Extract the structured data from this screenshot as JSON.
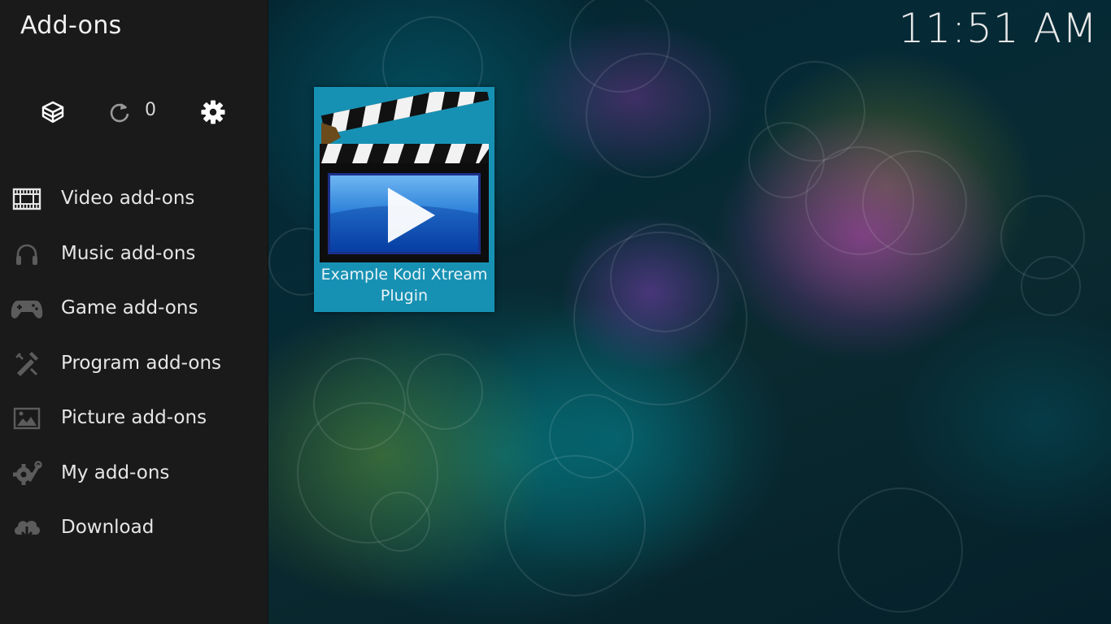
{
  "window": {
    "title": "Add-ons",
    "clock": "11:51 AM"
  },
  "toolbar": {
    "install_icon": "box-install-icon",
    "update_icon": "refresh-icon",
    "update_count": "0",
    "settings_icon": "gear-icon"
  },
  "sidebar": {
    "items": [
      {
        "label": "Video add-ons",
        "icon": "film-icon"
      },
      {
        "label": "Music add-ons",
        "icon": "headphones-icon"
      },
      {
        "label": "Game add-ons",
        "icon": "gamepad-icon"
      },
      {
        "label": "Program add-ons",
        "icon": "tools-icon"
      },
      {
        "label": "Picture add-ons",
        "icon": "picture-icon"
      },
      {
        "label": "My add-ons",
        "icon": "wrench-gear-icon"
      },
      {
        "label": "Download",
        "icon": "cloud-download-icon"
      }
    ]
  },
  "addons": [
    {
      "label": "Example Kodi Xtream Plugin",
      "icon": "clapperboard-play-icon"
    }
  ],
  "colors": {
    "sidebar_bg": "#1a1a1a",
    "tile_bg": "#1791b3",
    "text": "#e6e6e6"
  }
}
